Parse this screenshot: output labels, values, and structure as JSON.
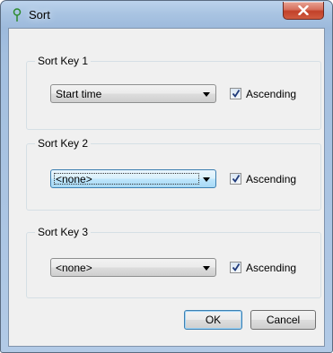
{
  "window": {
    "title": "Sort",
    "close_symbol": "x"
  },
  "sort_keys": [
    {
      "label": "Sort Key 1",
      "value": "Start time",
      "ascending_label": "Ascending",
      "ascending": true
    },
    {
      "label": "Sort Key 2",
      "value": "<none>",
      "ascending_label": "Ascending",
      "ascending": true
    },
    {
      "label": "Sort Key 3",
      "value": "<none>",
      "ascending_label": "Ascending",
      "ascending": true
    }
  ],
  "buttons": {
    "ok": "OK",
    "cancel": "Cancel"
  },
  "icons": {
    "app": "pin-icon",
    "close": "close-icon",
    "dropdown": "chevron-down-icon",
    "check": "check-icon"
  },
  "colors": {
    "close_button": "#c7452d",
    "focus_border": "#3c7fb1",
    "check_mark": "#1f3a7a"
  }
}
